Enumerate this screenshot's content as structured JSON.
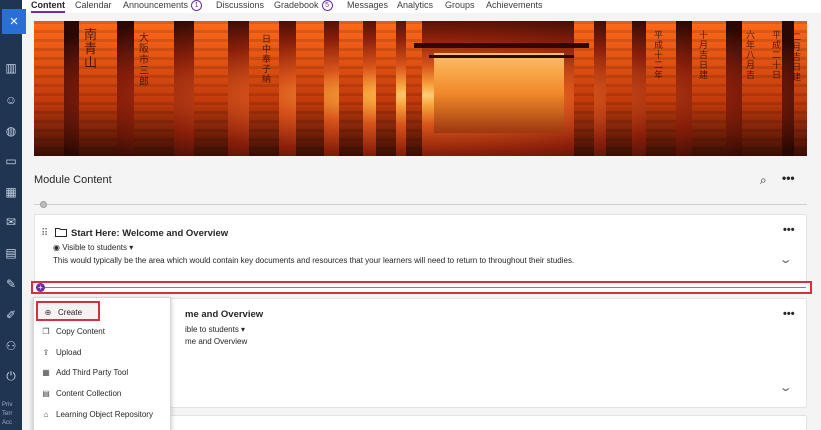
{
  "nav": {
    "tabs": [
      {
        "label": "Content",
        "active": true
      },
      {
        "label": "Calendar"
      },
      {
        "label": "Announcements",
        "badge": "1"
      },
      {
        "label": "Discussions"
      },
      {
        "label": "Gradebook",
        "badge": "5"
      },
      {
        "label": "Messages"
      },
      {
        "label": "Analytics"
      },
      {
        "label": "Groups"
      },
      {
        "label": "Achievements"
      }
    ]
  },
  "rail": {
    "close_icon": "×",
    "icons": [
      "institution-icon",
      "user-icon",
      "globe-icon",
      "courses-icon",
      "calendar-icon",
      "messages-icon",
      "grades-icon",
      "tools-icon",
      "edit-icon",
      "profile-icon",
      "signout-icon"
    ],
    "footer": [
      "Priv",
      "Terr",
      "Acc"
    ]
  },
  "module": {
    "title": "Module Content",
    "search_icon": "⌕",
    "more_icon": "•••"
  },
  "items": [
    {
      "title": "Start Here: Welcome and Overview",
      "visibility": "Visible to students",
      "description": "This would typically be the area which would contain key documents and resources that your learners will need to return to throughout their studies.",
      "more_icon": "•••",
      "chevron": "⌄"
    },
    {
      "title_partial": "me and Overview",
      "visibility_partial": "ible to students",
      "description_partial": "me and Overview",
      "more_icon": "•••",
      "chevron": "⌄"
    }
  ],
  "add_bar": {
    "plus_icon": "+"
  },
  "create_menu": {
    "items": [
      {
        "label": "Create",
        "icon": "plus-circle-icon",
        "glyph": "⊕",
        "highlighted": true
      },
      {
        "label": "Copy Content",
        "icon": "copy-icon",
        "glyph": "❐"
      },
      {
        "label": "Upload",
        "icon": "upload-icon",
        "glyph": "⇪"
      },
      {
        "label": "Add Third Party Tool",
        "icon": "tool-icon",
        "glyph": "▦"
      },
      {
        "label": "Content Collection",
        "icon": "collection-icon",
        "glyph": "▤"
      },
      {
        "label": "Learning Object Repository",
        "icon": "repository-icon",
        "glyph": "⌂"
      }
    ]
  },
  "colors": {
    "accent": "#6b2fa0",
    "highlight": "#d2323e",
    "rail": "#1f3552"
  }
}
